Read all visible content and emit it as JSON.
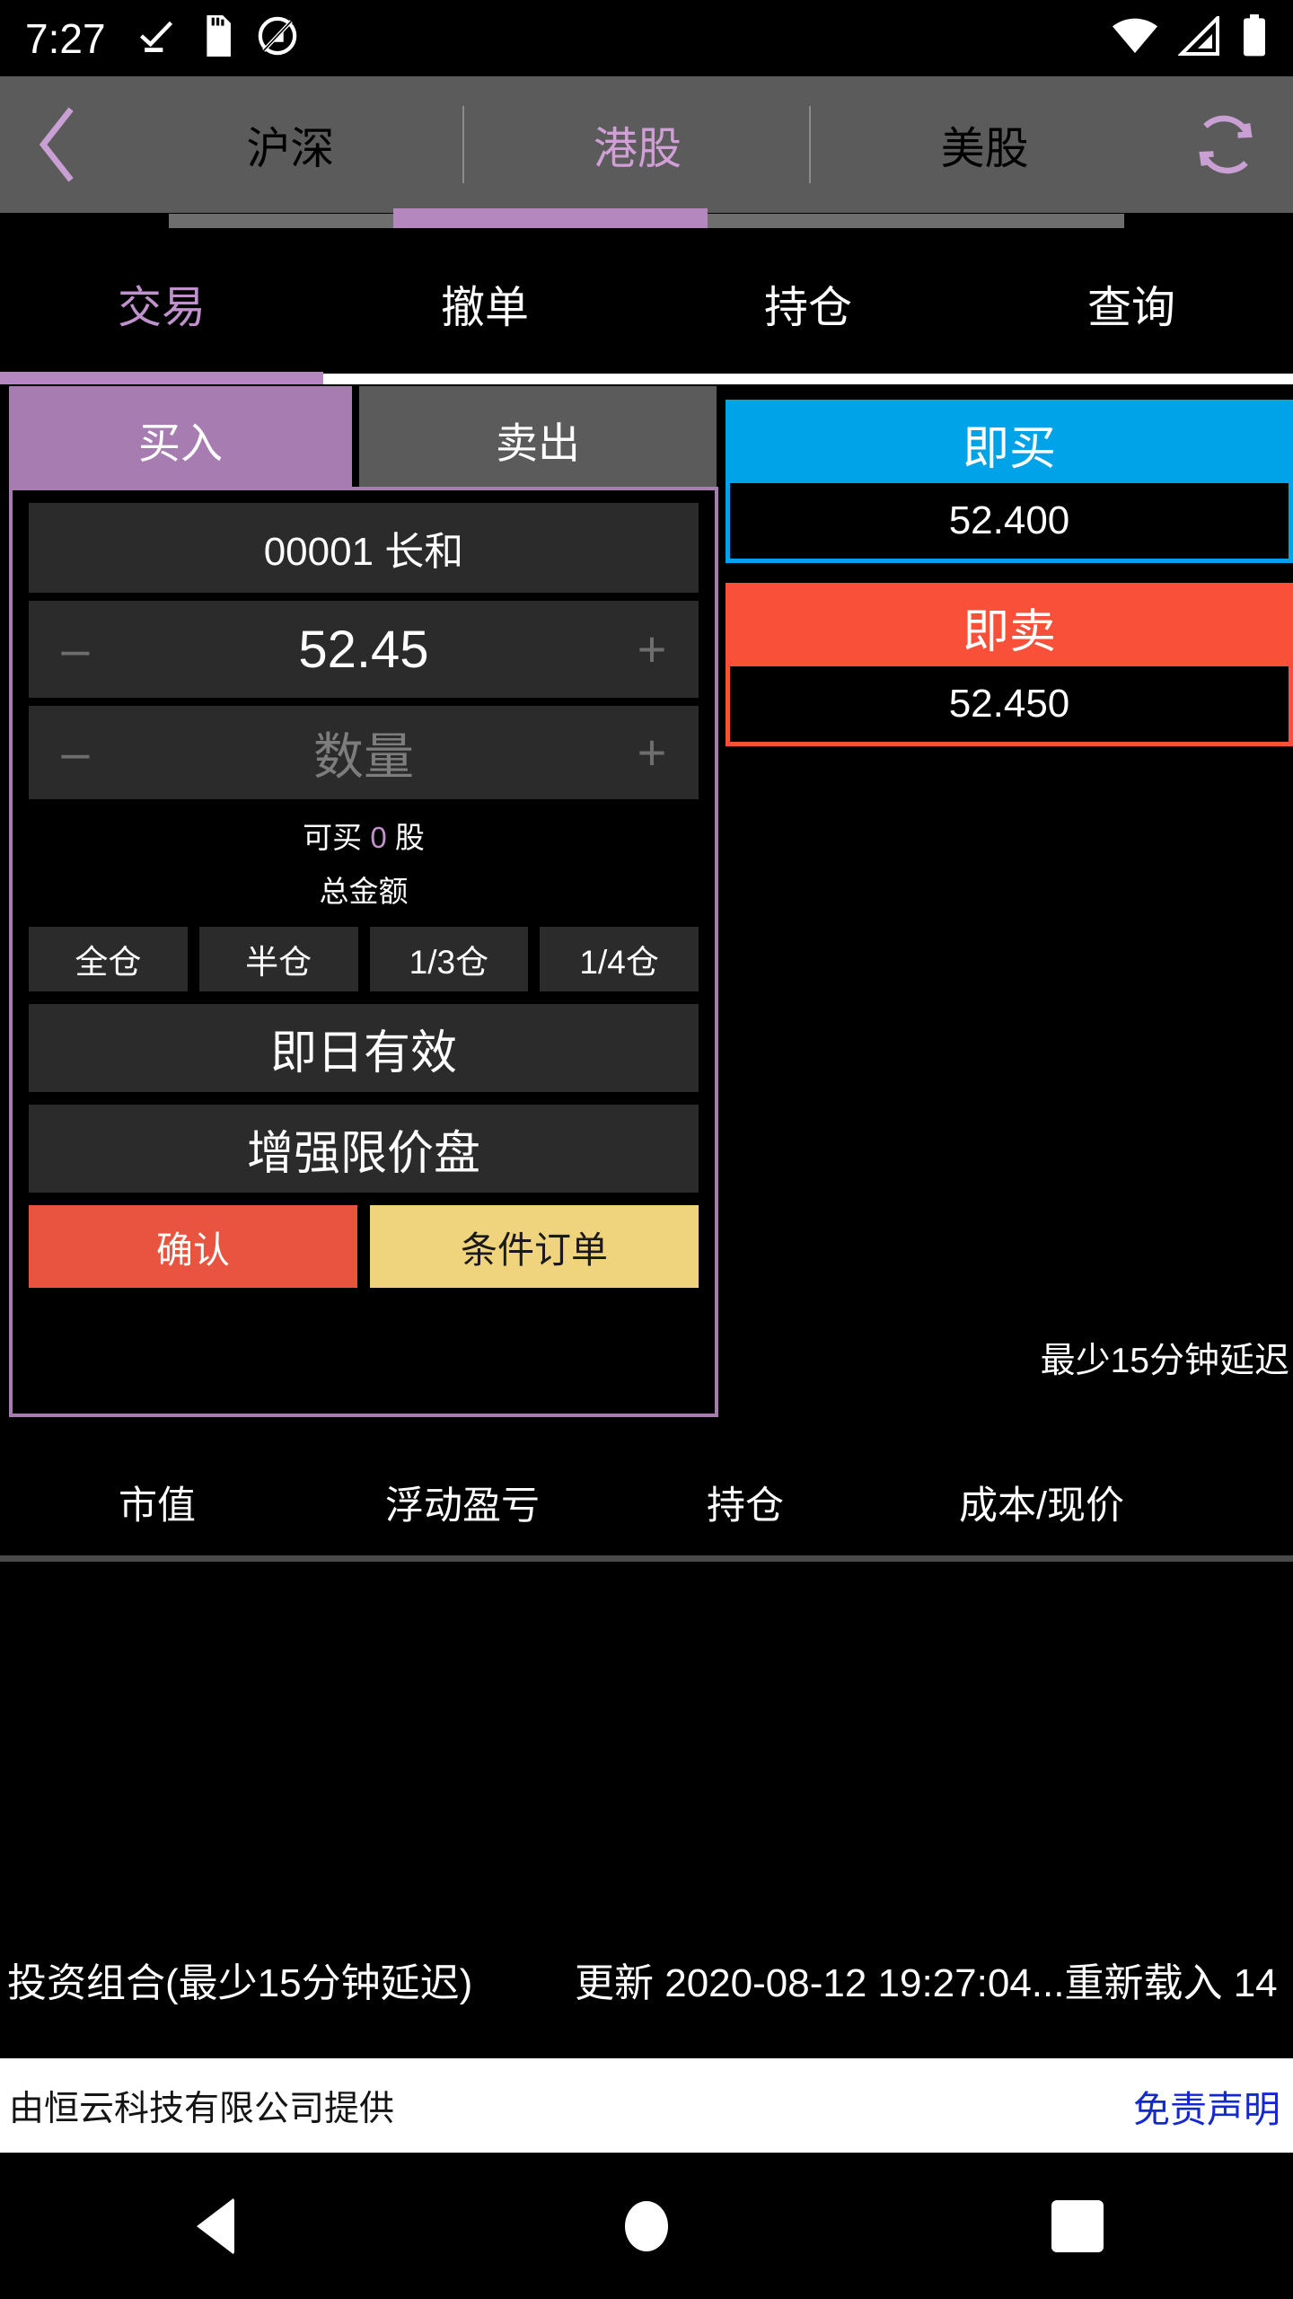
{
  "status_bar": {
    "time": "7:27",
    "left_icons": [
      "checkmark-icon",
      "sdcard-icon",
      "do-not-disturb-icon"
    ],
    "right_icons": [
      "wifi-icon",
      "signal-icon",
      "battery-icon"
    ]
  },
  "market_bar": {
    "back_icon": "chevron-left-icon",
    "refresh_icon": "refresh-icon",
    "tabs": [
      {
        "label": "沪深",
        "active": false
      },
      {
        "label": "港股",
        "active": true
      },
      {
        "label": "美股",
        "active": false
      }
    ]
  },
  "function_bar": {
    "tabs": [
      {
        "label": "交易",
        "active": true
      },
      {
        "label": "撤单",
        "active": false
      },
      {
        "label": "持仓",
        "active": false
      },
      {
        "label": "查询",
        "active": false
      }
    ]
  },
  "order_form": {
    "side_tabs": [
      {
        "label": "买入",
        "active": true
      },
      {
        "label": "卖出",
        "active": false
      }
    ],
    "symbol": "00001 长和",
    "price": "52.45",
    "quantity_placeholder": "数量",
    "quantity_value": "",
    "minus_glyph": "–",
    "plus_glyph": "+",
    "available_prefix": "可买",
    "available_qty": "0",
    "available_suffix": "股",
    "total_amount_label": "总金额",
    "total_amount_value": "",
    "position_buttons": [
      "全仓",
      "半仓",
      "1/3仓",
      "1/4仓"
    ],
    "validity": "即日有效",
    "order_type": "增强限价盘",
    "confirm_label": "确认",
    "conditional_label": "条件订单"
  },
  "quotes": {
    "bid": {
      "title": "即买",
      "price": "52.400",
      "color": "#00a3e8"
    },
    "ask": {
      "title": "即卖",
      "price": "52.450",
      "color": "#f9503a"
    },
    "delay_note": "最少15分钟延迟"
  },
  "portfolio": {
    "columns": [
      "市值",
      "浮动盈亏",
      "持仓",
      "成本/现价"
    ],
    "rows": []
  },
  "footer": {
    "portfolio_label": "投资组合(最少15分钟延迟)",
    "update_text": "更新 2020-08-12 19:27:04...重新载入 14"
  },
  "legal": {
    "provider": "由恒云科技有限公司提供",
    "disclaimer": "免责声明",
    "disclaimer_color": "#1428d2"
  },
  "nav_bar": {
    "buttons": [
      "back-icon",
      "home-icon",
      "recents-icon"
    ]
  }
}
